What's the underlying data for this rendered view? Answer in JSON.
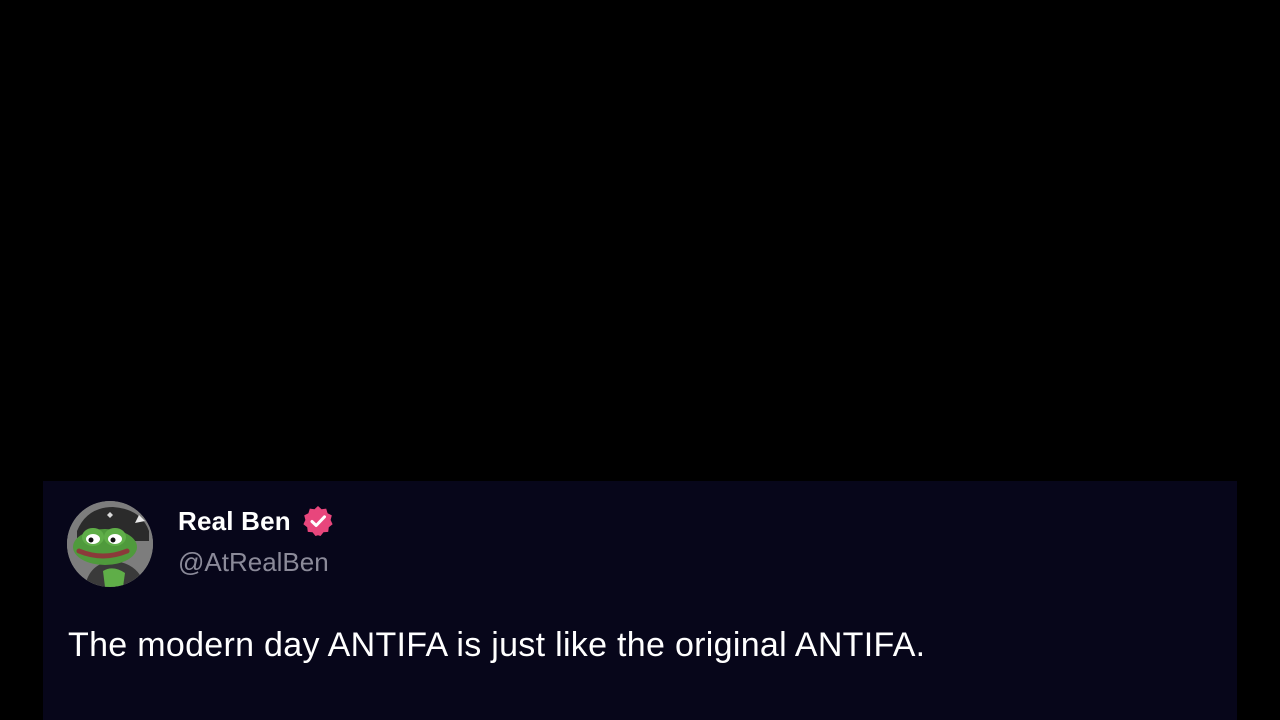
{
  "post": {
    "author": {
      "display_name": "Real Ben",
      "handle": "@AtRealBen",
      "verified": true,
      "avatar_icon": "frog-avatar-icon",
      "badge_icon": "verified-badge-icon"
    },
    "text": "The modern day ANTIFA is just like the original ANTIFA."
  },
  "colors": {
    "page_background": "#000000",
    "card_background": "#07061a",
    "name_text": "#ffffff",
    "handle_text": "#8b8a99",
    "verified_badge": "#e8467c"
  }
}
